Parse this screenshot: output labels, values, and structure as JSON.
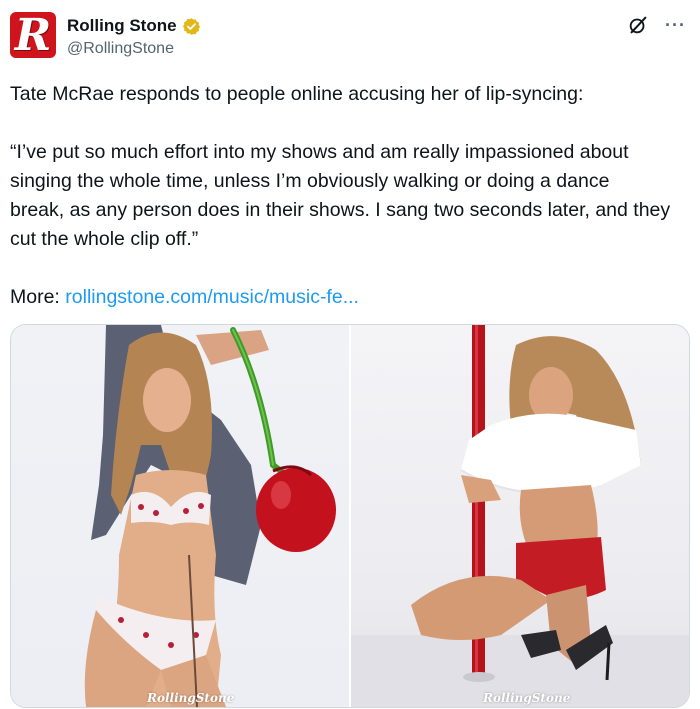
{
  "account": {
    "display_name": "Rolling Stone",
    "handle": "@RollingStone",
    "avatar_letter": "R",
    "verified": true
  },
  "tweet": {
    "line1": "Tate McRae responds to people online accusing her of lip-syncing:",
    "quote_line1": "“I’ve put so much effort into my shows and am really impassioned about",
    "quote_line2": "singing the whole time, unless I’m obviously walking or doing a dance",
    "quote_line3": "break, as any person does in their shows. I sang two seconds later, and they",
    "quote_line4": "cut the whole clip off.”",
    "more_label": "More:",
    "link_text": "rollingstone.com/music/music-fe..."
  },
  "media": {
    "left_watermark": "RollingStone",
    "right_watermark": "RollingStone"
  },
  "icons": {
    "verified": "verified-badge-icon",
    "grok": "grok-icon",
    "more": "more-options-icon"
  },
  "colors": {
    "brand_red": "#d0141e",
    "link_blue": "#1d9bf0",
    "verified_gold": "#e2b719",
    "text_secondary": "#536471"
  }
}
